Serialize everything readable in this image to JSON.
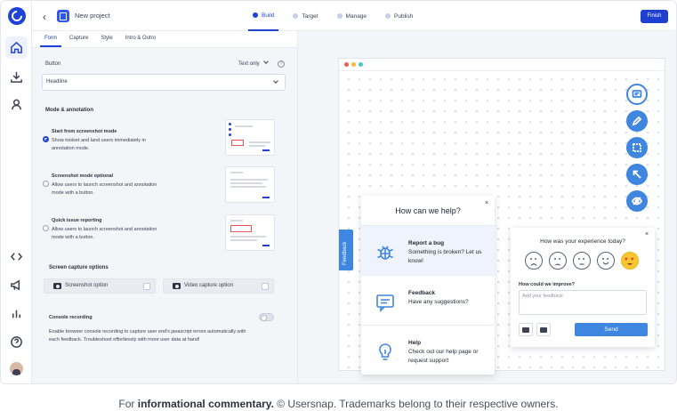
{
  "header": {
    "back_glyph": "‹",
    "project_title": "New project",
    "steps": [
      {
        "label": "Build",
        "active": true
      },
      {
        "label": "Target",
        "active": false
      },
      {
        "label": "Manage",
        "active": false
      },
      {
        "label": "Publish",
        "active": false
      }
    ],
    "finish_label": "Finish"
  },
  "rail": {
    "icons": [
      "home-icon",
      "download-icon",
      "user-icon",
      "code-icon",
      "megaphone-icon",
      "bar-chart-icon",
      "help-circle-icon"
    ]
  },
  "panel": {
    "tabs": [
      "Form",
      "Capture",
      "Style",
      "Intro & Outro"
    ],
    "button_label": "Button",
    "text_only": "Text only",
    "help_glyph": "?",
    "select_value": "Headline",
    "mode_section_title": "Mode & annotation",
    "modes": [
      {
        "title": "Start from screenshot mode",
        "desc": "Show toolset and land users immediately in annotation mode.",
        "selected": true
      },
      {
        "title": "Screenshot mode optional",
        "desc": "Allow users to launch screenshot and annotation mode with a button.",
        "selected": false
      },
      {
        "title": "Quick issue reporting",
        "desc": "Allow users to launch screenshot and annotation mode with a button.",
        "selected": false
      }
    ],
    "capture_section_title": "Screen capture options",
    "screenshot_option": "Screenshot option",
    "video_option": "Video capture option",
    "console_title": "Console recording",
    "console_desc": "Enable browser console recording to capture user end's javascript errors automatically with each feedback. Troubleshoot effortlessly with more user data at hand!"
  },
  "preview": {
    "window_dot_colors": [
      "#f25b5b",
      "#f5b83d",
      "#4cc3c8"
    ],
    "accent_color": "#3f86e0",
    "feedback_tab_label": "Feedback",
    "help_widget": {
      "title": "How can we help?",
      "close_glyph": "×",
      "items": [
        {
          "title": "Report a bug",
          "desc": "Something is broken? Let us know!",
          "icon": "bug-icon"
        },
        {
          "title": "Feedback",
          "desc": "Have any suggestions?",
          "icon": "chat-icon"
        },
        {
          "title": "Help",
          "desc": "Check out our help page or request support",
          "icon": "lightbulb-icon"
        }
      ]
    },
    "experience_widget": {
      "title": "How was your experience today?",
      "close_glyph": "×",
      "improve_label": "How could we improve?",
      "placeholder": "Add your feedback",
      "send_label": "Send",
      "heart_glyph": "♥"
    }
  },
  "caption": {
    "prefix": "For ",
    "bold": "informational commentary.",
    "suffix": " © Usersnap. Trademarks belong to their respective owners."
  }
}
